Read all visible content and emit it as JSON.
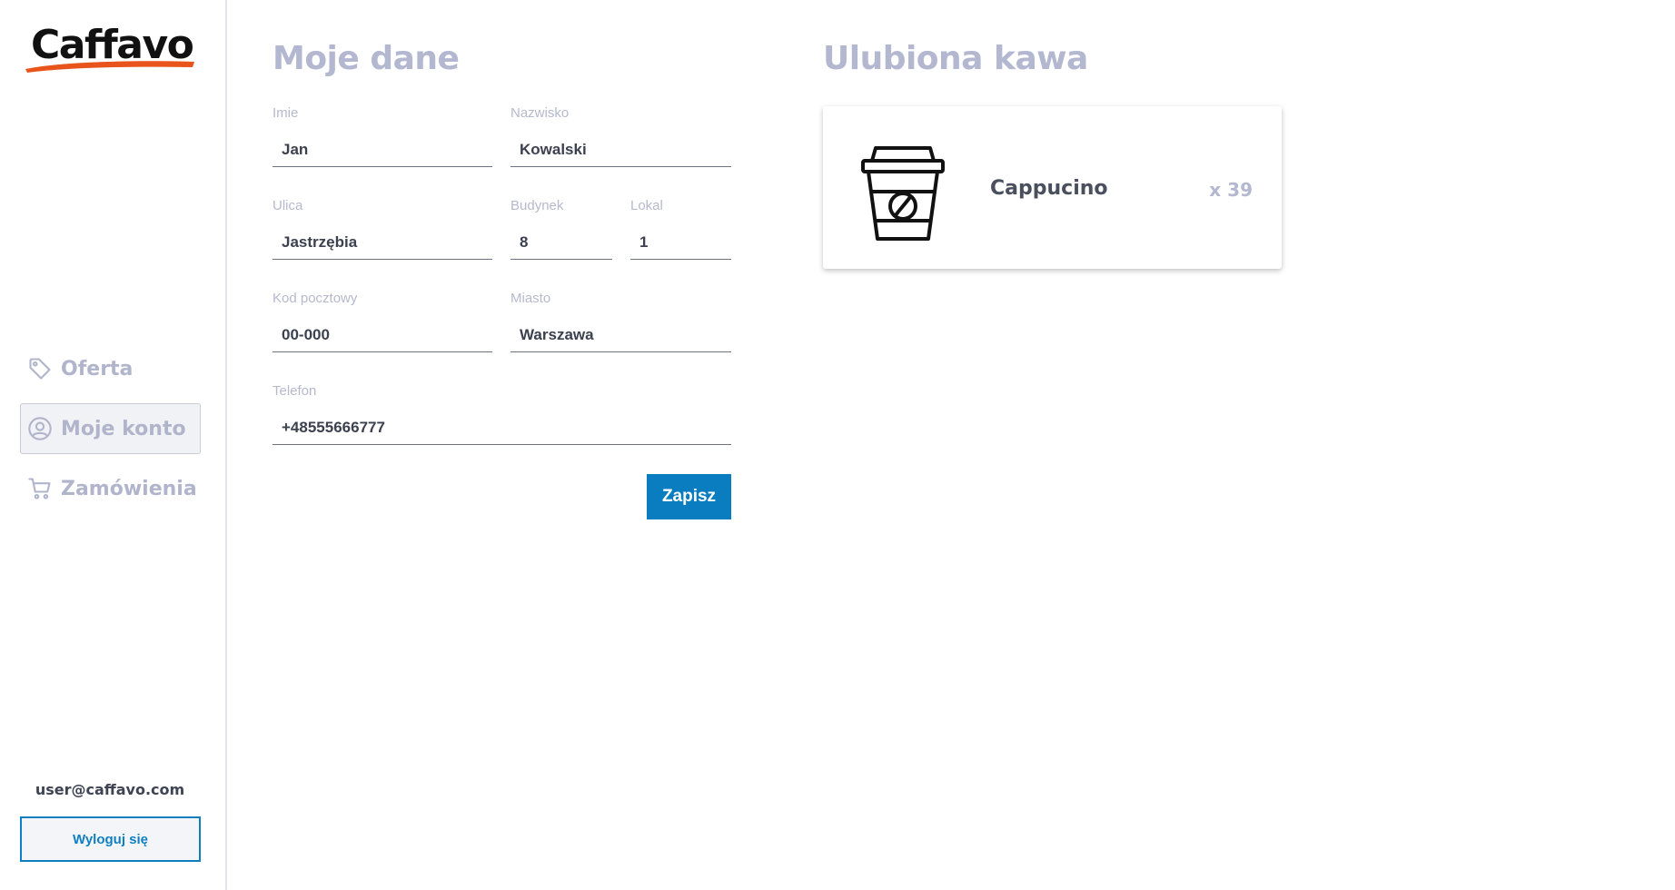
{
  "brand": {
    "name": "Caffavo",
    "accent": "#e8541b"
  },
  "sidebar": {
    "items": [
      {
        "label": "Oferta",
        "icon": "tag-icon",
        "active": false
      },
      {
        "label": "Moje konto",
        "icon": "user-circle-icon",
        "active": true
      },
      {
        "label": "Zamówienia",
        "icon": "cart-icon",
        "active": false
      }
    ],
    "user_email": "user@caffavo.com",
    "logout_label": "Wyloguj się"
  },
  "profile": {
    "title": "Moje dane",
    "fields": {
      "first_name": {
        "label": "Imie",
        "value": "Jan"
      },
      "last_name": {
        "label": "Nazwisko",
        "value": "Kowalski"
      },
      "street": {
        "label": "Ulica",
        "value": "Jastrzębia"
      },
      "building": {
        "label": "Budynek",
        "value": "8"
      },
      "apartment": {
        "label": "Lokal",
        "value": "1"
      },
      "postal_code": {
        "label": "Kod pocztowy",
        "value": "00-000"
      },
      "city": {
        "label": "Miasto",
        "value": "Warszawa"
      },
      "phone": {
        "label": "Telefon",
        "value": "+48555666777"
      }
    },
    "save_label": "Zapisz"
  },
  "favorite": {
    "title": "Ulubiona kawa",
    "name": "Cappucino",
    "count": "x 39",
    "icon": "coffee-cup-icon"
  },
  "colors": {
    "primary": "#0a7dc1",
    "muted": "#b3b7d0",
    "text": "#3c4150"
  }
}
